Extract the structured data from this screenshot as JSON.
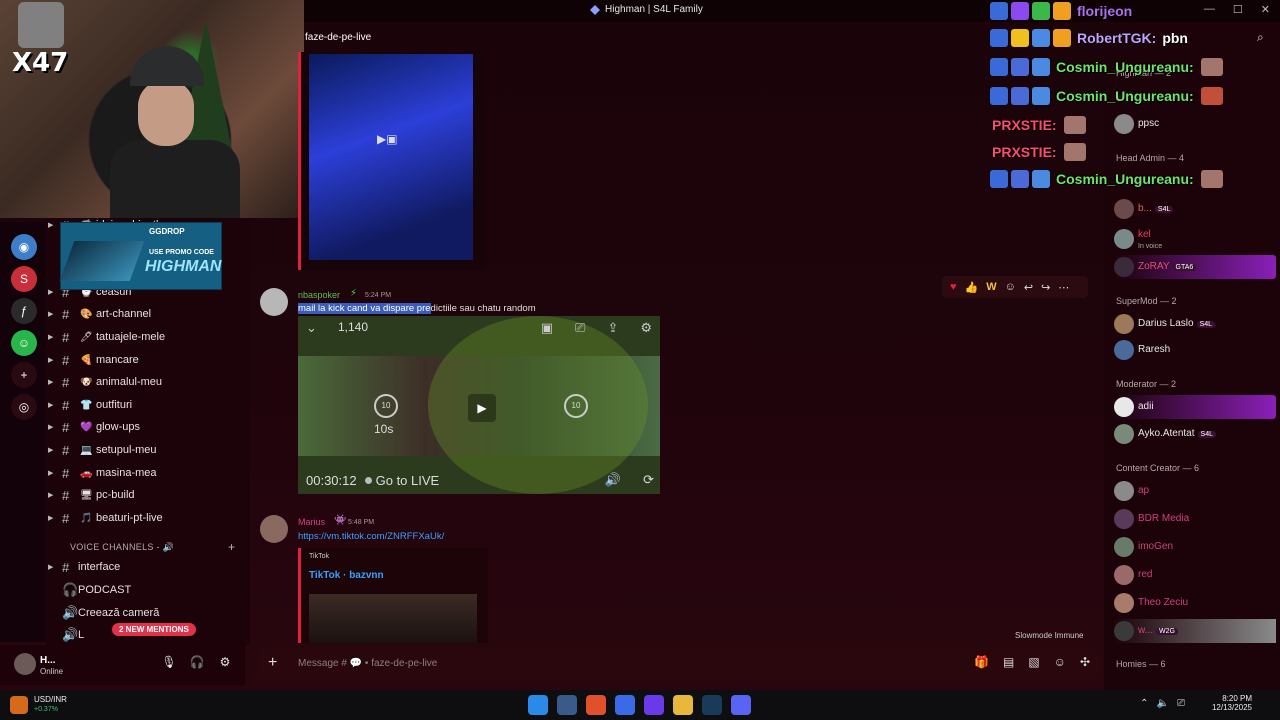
{
  "window": {
    "title": "Highman | S4L Family",
    "controls": [
      "—",
      "☐",
      "✕"
    ]
  },
  "stream": {
    "corner_label": "X47"
  },
  "promo": {
    "brand": "GGDROP",
    "use": "USE PROMO CODE",
    "code": "HIGHMAN"
  },
  "channels": {
    "items": [
      {
        "label": "idei-rechinathon",
        "emoji": "🦈"
      },
      {
        "label": "ceasuri",
        "emoji": "⌚"
      },
      {
        "label": "art-channel",
        "emoji": "🎨"
      },
      {
        "label": "tatuajele-mele",
        "emoji": "🖊"
      },
      {
        "label": "mancare",
        "emoji": "🍕"
      },
      {
        "label": "animalul-meu",
        "emoji": "🐶"
      },
      {
        "label": "outfituri",
        "emoji": "👕"
      },
      {
        "label": "glow-ups",
        "emoji": "💜"
      },
      {
        "label": "setupul-meu",
        "emoji": "💻"
      },
      {
        "label": "masina-mea",
        "emoji": "🚗"
      },
      {
        "label": "pc-build",
        "emoji": "🖥"
      },
      {
        "label": "beaturi-pt-live",
        "emoji": "🎵"
      }
    ],
    "voice_header": "VOICE CHANNELS - 🔊",
    "voice_items": [
      {
        "label": "interface",
        "icon": "#"
      },
      {
        "label": "PODCAST",
        "icon": "🎧"
      },
      {
        "label": "Creează cameră",
        "icon": "🔊"
      },
      {
        "label": "L",
        "icon": "🔊"
      }
    ],
    "mentions": "2 NEW MENTIONS"
  },
  "user": {
    "name": "H...",
    "status": "Online"
  },
  "chat": {
    "channel_title": "faze-de-pe-live",
    "message1": {
      "author": "nbaspoker",
      "time": "5:24 PM",
      "text_selected": "mail la kick cand va dispare pre",
      "text_rest": "dictiile sau chatu random",
      "video": {
        "viewers": "1,140",
        "skip": "10s",
        "timestamp": "00:30:12",
        "live": "Go to LIVE"
      }
    },
    "message2": {
      "author": "Marius",
      "time": "5:48 PM",
      "link": "https://vm.tiktok.com/ZNRFFXaUk/",
      "embed_site": "TikTok",
      "embed_title": "TikTok · bazvnn"
    },
    "slowmode": "Slowmode Immune",
    "composer_placeholder": "Message # 💬 • faze-de-pe-live"
  },
  "members": {
    "sections": [
      {
        "label": "Head Admin — 4"
      },
      {
        "label": "SuperMod — 2"
      },
      {
        "label": "Moderator — 2"
      },
      {
        "label": "Content Creator — 6"
      },
      {
        "label": "Homies — 6"
      }
    ],
    "top_partial": "Highman — 2",
    "list": [
      {
        "name": "ppsc",
        "color": "#e8e8e8",
        "sub": ""
      },
      {
        "name": "b...",
        "color": "#e06060",
        "sub": "",
        "tag": "S4L"
      },
      {
        "name": "kel",
        "color": "#e04050",
        "sub": "In voice"
      },
      {
        "name": "ZoRAY",
        "color": "#e05070",
        "sub": "",
        "tag": "GTA6"
      },
      {
        "name": "Darius Laslo",
        "color": "#e8e8e8",
        "sub": "",
        "tag": "S4L"
      },
      {
        "name": "Raresh",
        "color": "#e8e8e8",
        "sub": ""
      },
      {
        "name": "adii",
        "color": "#e8e8e8",
        "sub": ""
      },
      {
        "name": "Ayko.Atentat",
        "color": "#e8e8e8",
        "sub": "",
        "tag": "S4L"
      },
      {
        "name": "ap",
        "color": "#d04080",
        "sub": ""
      },
      {
        "name": "BDR Media",
        "color": "#d04080",
        "sub": ""
      },
      {
        "name": "imoGen",
        "color": "#d04080",
        "sub": ""
      },
      {
        "name": "red",
        "color": "#d04080",
        "sub": ""
      },
      {
        "name": "Theo Zeciu",
        "color": "#d04080",
        "sub": ""
      },
      {
        "name": "w...",
        "color": "#d04080",
        "sub": "",
        "tag": "W2G"
      }
    ]
  },
  "stream_chat": [
    {
      "name": "florijeon",
      "color": "#b46ef0",
      "msg": ""
    },
    {
      "name": "RobertTGK:",
      "color": "#c9a0ff",
      "msg": "pbn"
    },
    {
      "name": "Cosmin_Ungureanu:",
      "color": "#72e26a",
      "msg": ""
    },
    {
      "name": "Cosmin_Ungureanu:",
      "color": "#72e26a",
      "msg": ""
    },
    {
      "name": "PRXSTIE:",
      "color": "#ff4a72",
      "msg": ""
    },
    {
      "name": "PRXSTIE:",
      "color": "#ff4a72",
      "msg": ""
    },
    {
      "name": "Cosmin_Ungureanu:",
      "color": "#72e26a",
      "msg": ""
    }
  ],
  "taskbar": {
    "ticker": "USD/INR",
    "change": "+0.37%",
    "time": "8:20 PM",
    "date": "12/13/2025"
  },
  "colors": {
    "accent": "#e0213f",
    "link": "#3aa0ff",
    "bg": "#1a0309"
  }
}
